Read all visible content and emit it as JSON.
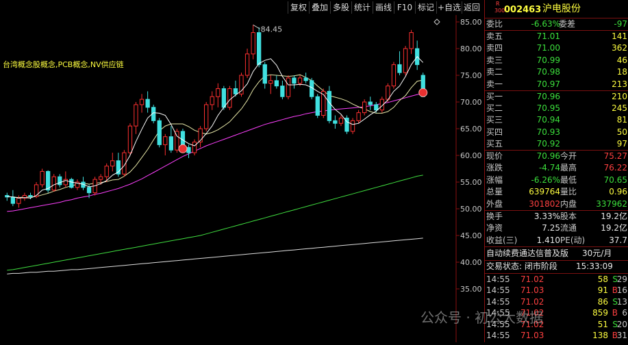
{
  "toolbar": {
    "buttons": [
      "复权",
      "叠加",
      "多股",
      "统计",
      "画线",
      "F10",
      "标记",
      "+自选",
      "返回"
    ]
  },
  "chart": {
    "concept_text": "台湾概念股概念,PCB概念,NV供应链",
    "high_label": "84.45",
    "y_axis_ticks": [
      "85.00",
      "80.00",
      "75.00",
      "70.00",
      "65.00",
      "60.00",
      "55.00",
      "50.00",
      "45.00",
      "40.00",
      "35.00"
    ],
    "colors": {
      "up": "#ff3030",
      "down": "#40e0e0",
      "ma5": "#ffffff",
      "ma10": "#e8e8a8",
      "ma20": "#ff40ff",
      "ma60": "#40e040",
      "ma120": "#e0e0e0",
      "axis": "#8a1010"
    },
    "candles": [
      [
        52.5,
        53.0,
        51.5,
        52.2
      ],
      [
        52.2,
        53.5,
        50.5,
        51.0
      ],
      [
        51.0,
        52.5,
        50.2,
        52.0
      ],
      [
        52.0,
        53.0,
        51.5,
        52.5
      ],
      [
        52.5,
        53.0,
        51.8,
        52.3
      ],
      [
        52.3,
        55.0,
        52.0,
        54.5
      ],
      [
        54.5,
        57.5,
        54.0,
        57.0
      ],
      [
        57.0,
        57.2,
        53.0,
        53.5
      ],
      [
        53.5,
        56.5,
        53.2,
        56.0
      ],
      [
        56.0,
        56.5,
        54.0,
        54.5
      ],
      [
        54.5,
        57.0,
        54.0,
        55.5
      ],
      [
        55.5,
        55.8,
        53.8,
        54.0
      ],
      [
        54.0,
        55.5,
        53.5,
        55.0
      ],
      [
        55.0,
        56.0,
        53.5,
        54.0
      ],
      [
        54.0,
        54.5,
        52.0,
        53.0
      ],
      [
        53.0,
        56.0,
        52.5,
        55.5
      ],
      [
        55.5,
        56.5,
        54.5,
        56.0
      ],
      [
        56.0,
        58.5,
        55.0,
        58.0
      ],
      [
        58.0,
        60.5,
        57.0,
        59.0
      ],
      [
        59.0,
        60.5,
        56.0,
        56.5
      ],
      [
        56.5,
        61.0,
        56.0,
        60.5
      ],
      [
        60.5,
        66.0,
        60.0,
        65.5
      ],
      [
        65.5,
        70.0,
        64.0,
        69.5
      ],
      [
        69.5,
        71.5,
        68.0,
        70.5
      ],
      [
        70.5,
        72.0,
        68.0,
        69.0
      ],
      [
        69.0,
        69.5,
        66.0,
        66.5
      ],
      [
        66.5,
        67.0,
        61.5,
        62.0
      ],
      [
        62.0,
        64.0,
        60.0,
        63.5
      ],
      [
        63.5,
        65.5,
        60.5,
        61.0
      ],
      [
        61.0,
        65.0,
        60.5,
        64.5
      ],
      [
        64.5,
        65.0,
        61.0,
        61.5
      ],
      [
        61.5,
        62.0,
        59.5,
        60.5
      ],
      [
        60.5,
        63.0,
        60.0,
        62.5
      ],
      [
        62.5,
        65.5,
        61.5,
        65.0
      ],
      [
        65.0,
        70.0,
        64.5,
        69.5
      ],
      [
        69.5,
        72.0,
        68.5,
        71.0
      ],
      [
        71.0,
        73.5,
        69.0,
        72.5
      ],
      [
        72.5,
        73.0,
        68.5,
        69.0
      ],
      [
        69.0,
        73.0,
        68.5,
        72.5
      ],
      [
        72.5,
        74.0,
        71.0,
        71.5
      ],
      [
        71.5,
        75.5,
        71.0,
        75.0
      ],
      [
        75.0,
        80.0,
        74.5,
        79.0
      ],
      [
        79.0,
        84.45,
        78.0,
        83.0
      ],
      [
        83.0,
        84.0,
        76.5,
        77.0
      ],
      [
        77.0,
        77.5,
        72.5,
        73.5
      ],
      [
        73.5,
        75.0,
        71.5,
        74.0
      ],
      [
        74.0,
        75.0,
        72.5,
        73.0
      ],
      [
        73.0,
        74.0,
        70.5,
        71.0
      ],
      [
        71.0,
        75.0,
        70.5,
        74.5
      ],
      [
        74.5,
        75.0,
        72.5,
        73.5
      ],
      [
        73.5,
        75.0,
        73.0,
        74.5
      ],
      [
        74.5,
        75.5,
        73.5,
        74.0
      ],
      [
        74.0,
        74.5,
        70.5,
        71.0
      ],
      [
        71.0,
        71.5,
        67.0,
        67.5
      ],
      [
        67.5,
        72.5,
        67.0,
        72.0
      ],
      [
        72.0,
        73.0,
        66.0,
        66.5
      ],
      [
        66.5,
        67.5,
        65.0,
        66.0
      ],
      [
        66.0,
        67.5,
        65.5,
        67.0
      ],
      [
        67.0,
        67.5,
        64.0,
        64.5
      ],
      [
        64.5,
        67.0,
        64.0,
        66.5
      ],
      [
        66.5,
        68.5,
        66.0,
        68.0
      ],
      [
        68.0,
        70.5,
        67.5,
        70.0
      ],
      [
        70.0,
        71.0,
        68.5,
        69.5
      ],
      [
        69.5,
        70.0,
        68.0,
        68.5
      ],
      [
        68.5,
        71.0,
        68.0,
        70.5
      ],
      [
        70.5,
        73.5,
        70.0,
        73.0
      ],
      [
        73.0,
        77.5,
        72.5,
        77.0
      ],
      [
        77.0,
        79.5,
        75.0,
        75.5
      ],
      [
        75.5,
        80.5,
        75.0,
        80.0
      ],
      [
        80.0,
        83.5,
        79.0,
        83.0
      ],
      [
        80.0,
        81.5,
        76.0,
        77.0
      ],
      [
        75.0,
        75.5,
        70.9,
        71.0
      ]
    ],
    "ma5": [
      52.3,
      52.2,
      52.0,
      52.1,
      52.0,
      52.5,
      53.5,
      53.8,
      54.5,
      54.9,
      55.3,
      55.0,
      54.8,
      54.6,
      54.1,
      54.3,
      54.7,
      55.3,
      56.3,
      56.9,
      58.1,
      60.0,
      62.6,
      64.9,
      67.0,
      68.0,
      67.9,
      67.5,
      65.8,
      63.6,
      62.9,
      62.2,
      61.8,
      62.8,
      64.1,
      65.5,
      67.5,
      69.0,
      70.4,
      71.3,
      72.1,
      73.4,
      75.7,
      77.2,
      77.8,
      78.1,
      76.9,
      74.8,
      73.2,
      73.2,
      73.3,
      73.2,
      72.7,
      72.0,
      71.4,
      69.9,
      68.6,
      67.7,
      66.3,
      65.8,
      66.0,
      66.8,
      67.6,
      68.3,
      69.3,
      70.4,
      72.0,
      73.0,
      74.8,
      77.0,
      78.5,
      77.4
    ],
    "ma10": [
      52.3,
      52.2,
      52.1,
      52.2,
      52.2,
      52.3,
      52.6,
      52.9,
      53.3,
      53.6,
      54.0,
      54.3,
      54.6,
      54.8,
      54.6,
      54.8,
      54.9,
      55.1,
      55.4,
      55.5,
      56.1,
      56.9,
      58.1,
      59.6,
      61.1,
      62.9,
      64.6,
      65.5,
      65.9,
      65.9,
      65.9,
      65.4,
      64.7,
      64.3,
      64.0,
      64.3,
      64.8,
      65.5,
      66.3,
      67.5,
      68.7,
      70.3,
      72.3,
      73.8,
      74.9,
      75.1,
      75.0,
      74.9,
      74.8,
      74.9,
      75.1,
      74.6,
      74.0,
      73.0,
      72.1,
      71.2,
      70.9,
      70.6,
      70.2,
      69.6,
      69.1,
      68.7,
      68.2,
      67.9,
      67.9,
      68.2,
      69.0,
      70.3,
      71.2,
      72.7,
      73.9,
      74.1
    ],
    "ma20": [
      49.5,
      49.6,
      49.8,
      50.0,
      50.2,
      50.4,
      50.6,
      50.8,
      51.0,
      51.2,
      51.5,
      51.7,
      52.0,
      52.2,
      52.4,
      52.7,
      52.9,
      53.2,
      53.5,
      53.8,
      54.2,
      54.6,
      55.1,
      55.6,
      56.2,
      56.8,
      57.4,
      58.0,
      58.6,
      59.2,
      59.8,
      60.3,
      60.8,
      61.3,
      61.8,
      62.2,
      62.6,
      63.0,
      63.4,
      63.8,
      64.2,
      64.6,
      65.0,
      65.4,
      65.8,
      66.1,
      66.4,
      66.7,
      67.0,
      67.3,
      67.5,
      67.8,
      68.0,
      68.2,
      68.3,
      68.5,
      68.6,
      68.7,
      68.8,
      68.9,
      69.0,
      69.1,
      69.3,
      69.5,
      69.7,
      69.9,
      70.2,
      70.5,
      70.8,
      71.1,
      71.4,
      71.6
    ],
    "ma60": [
      38.5,
      38.6,
      38.8,
      39.0,
      39.2,
      39.4,
      39.6,
      39.8,
      40.0,
      40.2,
      40.4,
      40.6,
      40.8,
      41.0,
      41.2,
      41.4,
      41.6,
      41.8,
      42.0,
      42.2,
      42.4,
      42.6,
      42.8,
      43.0,
      43.2,
      43.4,
      43.6,
      43.8,
      44.0,
      44.2,
      44.4,
      44.6,
      44.8,
      45.0,
      45.3,
      45.6,
      45.9,
      46.2,
      46.5,
      46.8,
      47.1,
      47.4,
      47.7,
      48.0,
      48.3,
      48.6,
      48.9,
      49.2,
      49.5,
      49.8,
      50.1,
      50.4,
      50.7,
      51.0,
      51.3,
      51.6,
      51.9,
      52.2,
      52.5,
      52.8,
      53.1,
      53.4,
      53.7,
      54.0,
      54.3,
      54.6,
      54.9,
      55.2,
      55.5,
      55.8,
      56.1,
      56.3
    ],
    "ma120": [
      37.8,
      37.9,
      37.9,
      38.0,
      38.1,
      38.1,
      38.2,
      38.3,
      38.3,
      38.4,
      38.5,
      38.6,
      38.6,
      38.7,
      38.8,
      38.9,
      39.0,
      39.1,
      39.2,
      39.3,
      39.4,
      39.5,
      39.6,
      39.7,
      39.8,
      39.9,
      40.0,
      40.1,
      40.2,
      40.3,
      40.4,
      40.5,
      40.6,
      40.7,
      40.8,
      40.9,
      41.0,
      41.1,
      41.2,
      41.3,
      41.4,
      41.5,
      41.6,
      41.7,
      41.8,
      41.9,
      42.0,
      42.1,
      42.2,
      42.3,
      42.4,
      42.5,
      42.6,
      42.7,
      42.8,
      42.9,
      43.0,
      43.1,
      43.2,
      43.3,
      43.4,
      43.5,
      43.6,
      43.7,
      43.8,
      43.9,
      44.0,
      44.1,
      44.2,
      44.3,
      44.4,
      44.5
    ],
    "markers": [
      30,
      71
    ]
  },
  "quote": {
    "code_prefix_top": "R",
    "code_prefix_bottom": "300",
    "code": "002463",
    "name": "沪电股份",
    "weibi_label": "委比",
    "weibi_value": "-6.63%",
    "weicha_label": "委差",
    "weicha_value": "-97",
    "asks": [
      {
        "label": "卖五",
        "price": "71.01",
        "vol": "141"
      },
      {
        "label": "卖四",
        "price": "71.00",
        "vol": "362"
      },
      {
        "label": "卖三",
        "price": "70.99",
        "vol": "46"
      },
      {
        "label": "卖二",
        "price": "70.98",
        "vol": "18"
      },
      {
        "label": "卖一",
        "price": "70.97",
        "vol": "213"
      }
    ],
    "bids": [
      {
        "label": "买一",
        "price": "70.96",
        "vol": "210"
      },
      {
        "label": "买二",
        "price": "70.95",
        "vol": "245"
      },
      {
        "label": "买三",
        "price": "70.94",
        "vol": "81"
      },
      {
        "label": "买四",
        "price": "70.93",
        "vol": "50"
      },
      {
        "label": "买五",
        "price": "70.92",
        "vol": "97"
      }
    ],
    "stats": [
      {
        "l1": "现价",
        "v1": "70.96",
        "c1": "green",
        "l2": "今开",
        "v2": "75.27",
        "c2": "red"
      },
      {
        "l1": "涨跌",
        "v1": "-4.74",
        "c1": "green",
        "l2": "最高",
        "v2": "76.22",
        "c2": "red"
      },
      {
        "l1": "涨幅",
        "v1": "-6.26%",
        "c1": "green",
        "l2": "最低",
        "v2": "70.65",
        "c2": "green"
      },
      {
        "l1": "总量",
        "v1": "639764",
        "c1": "yellow",
        "l2": "量比",
        "v2": "0.96",
        "c2": "yellow"
      },
      {
        "l1": "外盘",
        "v1": "301802",
        "c1": "red",
        "l2": "内盘",
        "v2": "337962",
        "c2": "green"
      }
    ],
    "stats2": [
      {
        "l1": "换手",
        "v1": "3.33%",
        "c1": "white",
        "l2": "股本",
        "v2": "19.2亿",
        "c2": "white"
      },
      {
        "l1": "净资",
        "v1": "7.25",
        "c1": "white",
        "l2": "流通",
        "v2": "19.2亿",
        "c2": "white"
      },
      {
        "l1": "收益(三)",
        "v1": "1.410",
        "c1": "white",
        "l2": "PE(动)",
        "v2": "37.7",
        "c2": "white"
      }
    ],
    "promo_text": "自动续费通达信普及版",
    "promo_price": "30元/月",
    "status_label": "交易状态: 闭市阶段",
    "status_time": "15:33:09",
    "ticks": [
      {
        "time": "14:55",
        "price": "71.02",
        "vol": "58",
        "bs": "S",
        "bsc": "green",
        "x": "29"
      },
      {
        "time": "14:55",
        "price": "71.03",
        "vol": "91",
        "bs": "B",
        "bsc": "red",
        "x": "16"
      },
      {
        "time": "14:55",
        "price": "71.02",
        "vol": "86",
        "bs": "S",
        "bsc": "green",
        "x": "13"
      },
      {
        "time": "14:55",
        "price": "71.02",
        "vol": "859",
        "bs": "B",
        "bsc": "red",
        "x": "6"
      },
      {
        "time": "14:55",
        "price": "71.02",
        "vol": "51",
        "bs": "S",
        "bsc": "green",
        "x": "20"
      },
      {
        "time": "14:55",
        "price": "71.03",
        "vol": "138",
        "bs": "B",
        "bsc": "red",
        "x": "31"
      }
    ]
  },
  "watermark": "公众号 · 初公大数据"
}
